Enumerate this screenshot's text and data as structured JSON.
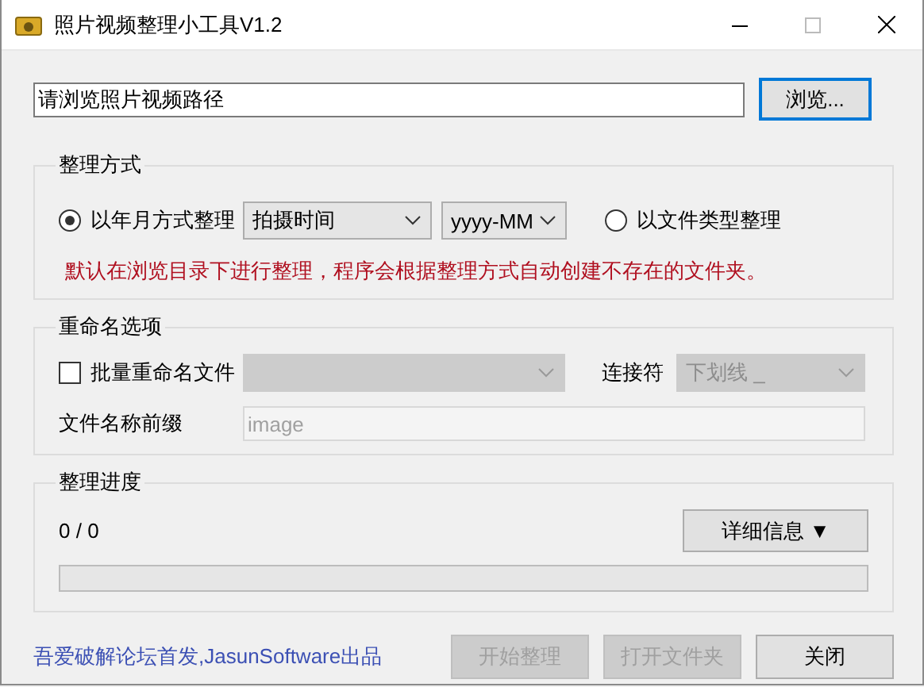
{
  "window": {
    "title": "照片视频整理小工具V1.2"
  },
  "path_field": {
    "value": "请浏览照片视频路径"
  },
  "browse_button": {
    "label": "浏览..."
  },
  "organize_group": {
    "title": "整理方式",
    "options": [
      {
        "label": "以年月方式整理",
        "selected": true
      },
      {
        "label": "以文件类型整理",
        "selected": false
      }
    ],
    "time_source": {
      "value": "拍摄时间"
    },
    "date_format": {
      "value": "yyyy-MM"
    },
    "note": "默认在浏览目录下进行整理，程序会根据整理方式自动创建不存在的文件夹。"
  },
  "rename_group": {
    "title": "重命名选项",
    "batch_rename": {
      "label": "批量重命名文件",
      "checked": false
    },
    "separator": {
      "label": "连接符",
      "value": "下划线 _"
    },
    "prefix": {
      "label": "文件名称前缀",
      "value": "image"
    }
  },
  "progress_group": {
    "title": "整理进度",
    "count": "0 / 0",
    "details_button": "详细信息 ▼",
    "progress": {
      "level": 0
    }
  },
  "footer": {
    "credit": "吾爱破解论坛首发,JasunSoftware出品",
    "buttons": [
      {
        "label": "开始整理",
        "disabled": true
      },
      {
        "label": "打开文件夹",
        "disabled": true
      },
      {
        "label": "关闭",
        "disabled": false
      }
    ]
  }
}
